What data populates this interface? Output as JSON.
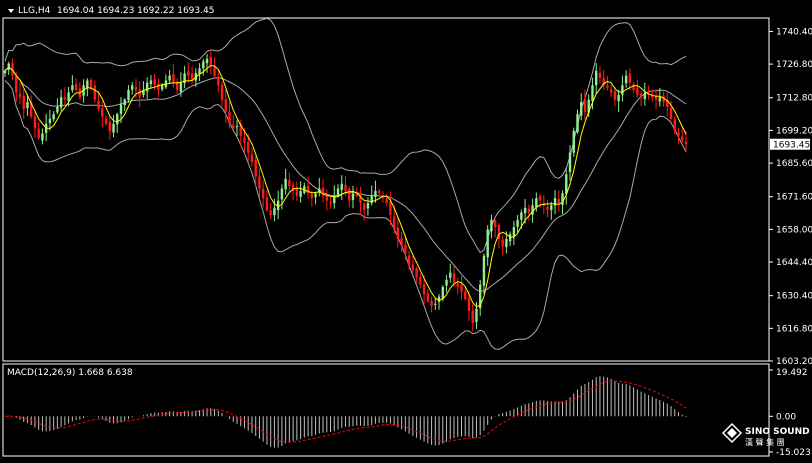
{
  "header": {
    "symbol_timeframe": "LLG,H4",
    "ohlc": "1694.04 1694.23 1692.22 1693.45"
  },
  "macd_header": "MACD(12,26,9) 1.668 6.638",
  "last_price_label": "1693.45",
  "brand": {
    "name": "SINO SOUND",
    "sub": "漢 聲 集 團"
  },
  "colors": {
    "background": "#000000",
    "bull": "#90ee90",
    "bear": "#ff1a1a",
    "band": "#a9a9a9",
    "ma": "#ffff00",
    "macd_signal": "#ff0000",
    "macd_hist": "#c0c0c0",
    "axis": "#ffffff"
  },
  "chart_data": [
    {
      "type": "candlestick",
      "title": "LLG,H4",
      "ylim": [
        1603.2,
        1746.0
      ],
      "y_ticks": [
        "1740.40",
        "1726.80",
        "1712.80",
        "1699.20",
        "1685.60",
        "1671.60",
        "1658.00",
        "1644.40",
        "1630.40",
        "1616.80",
        "1603.20"
      ],
      "overlays": [
        "Bollinger Bands",
        "Moving Average"
      ],
      "grid": false,
      "series": [
        {
          "name": "Price",
          "close": [
            1724,
            1727,
            1722,
            1715,
            1713,
            1708,
            1711,
            1705,
            1700,
            1696,
            1698,
            1702,
            1704,
            1706,
            1709,
            1713,
            1712,
            1715,
            1718,
            1716,
            1713,
            1718,
            1720,
            1717,
            1712,
            1708,
            1705,
            1702,
            1699,
            1702,
            1706,
            1710,
            1712,
            1716,
            1718,
            1716,
            1713,
            1716,
            1719,
            1720,
            1718,
            1716,
            1718,
            1720,
            1722,
            1719,
            1716,
            1719,
            1723,
            1722,
            1720,
            1723,
            1725,
            1728,
            1729,
            1726,
            1722,
            1718,
            1712,
            1707,
            1702,
            1700,
            1701,
            1697,
            1694,
            1690,
            1686,
            1680,
            1675,
            1671,
            1666,
            1664,
            1667,
            1670,
            1675,
            1679,
            1676,
            1674,
            1672,
            1674,
            1676,
            1673,
            1671,
            1673,
            1675,
            1672,
            1670,
            1669,
            1672,
            1675,
            1677,
            1674,
            1670,
            1673,
            1672,
            1669,
            1666,
            1669,
            1672,
            1674,
            1673,
            1671,
            1669,
            1664,
            1658,
            1654,
            1651,
            1648,
            1643,
            1641,
            1638,
            1635,
            1631,
            1628,
            1626,
            1627,
            1630,
            1634,
            1637,
            1640,
            1636,
            1634,
            1632,
            1629,
            1624,
            1619,
            1625,
            1635,
            1647,
            1658,
            1662,
            1659,
            1654,
            1651,
            1654,
            1656,
            1659,
            1662,
            1665,
            1667,
            1665,
            1668,
            1671,
            1670,
            1668,
            1666,
            1668,
            1671,
            1669,
            1673,
            1681,
            1690,
            1699,
            1706,
            1711,
            1707,
            1712,
            1718,
            1724,
            1721,
            1718,
            1717,
            1715,
            1712,
            1714,
            1718,
            1722,
            1719,
            1716,
            1714,
            1713,
            1715,
            1714,
            1713,
            1712,
            1713,
            1711,
            1709,
            1704,
            1699,
            1697,
            1695,
            1693.45
          ],
          "last": 1693.45
        },
        {
          "name": "MA",
          "type": "line"
        },
        {
          "name": "Bollinger Bands",
          "type": "band"
        }
      ]
    },
    {
      "type": "bar",
      "title": "MACD(12,26,9)",
      "macd_value": 1.668,
      "signal_value": 6.638,
      "ylim": [
        -15.023,
        19.492
      ],
      "y_ticks": [
        "19.492",
        "0.00",
        "-15.023"
      ],
      "series": [
        {
          "name": "MACD",
          "type": "histogram"
        },
        {
          "name": "Signal",
          "type": "dashed-line"
        }
      ]
    }
  ]
}
